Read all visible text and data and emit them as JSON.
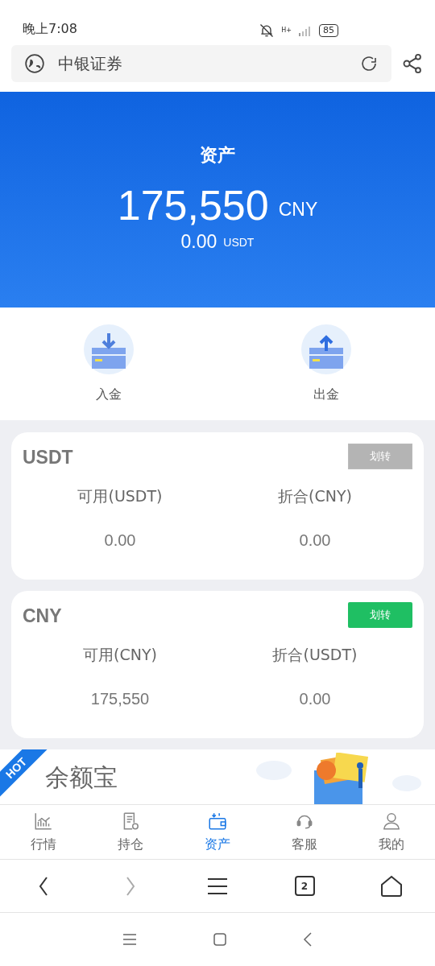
{
  "status_bar": {
    "time": "晚上7:08",
    "network": "H+",
    "battery": "85"
  },
  "address_bar": {
    "title": "中银证券"
  },
  "header": {
    "title": "资产",
    "total": "175,550",
    "total_unit": "CNY",
    "usdt": "0.00",
    "usdt_unit": "USDT"
  },
  "actions": [
    {
      "kind": "deposit",
      "label": "入金"
    },
    {
      "kind": "withdraw",
      "label": "出金"
    }
  ],
  "accounts": [
    {
      "name": "USDT",
      "button": "划转",
      "disabled": true,
      "columns": [
        {
          "label": "可用(USDT)",
          "value": "0.00"
        },
        {
          "label": "折合(CNY)",
          "value": "0.00"
        }
      ]
    },
    {
      "name": "CNY",
      "button": "划转",
      "disabled": false,
      "columns": [
        {
          "label": "可用(CNY)",
          "value": "175,550"
        },
        {
          "label": "折合(USDT)",
          "value": "0.00"
        }
      ]
    }
  ],
  "banner": {
    "ribbon": "HOT",
    "title": "余额宝"
  },
  "tabs": [
    {
      "kind": "chart",
      "label": "行情",
      "selected": false
    },
    {
      "kind": "doc",
      "label": "持仓",
      "selected": false
    },
    {
      "kind": "wallet",
      "label": "资产",
      "selected": true
    },
    {
      "kind": "headset",
      "label": "客服",
      "selected": false
    },
    {
      "kind": "user",
      "label": "我的",
      "selected": false
    }
  ],
  "browser_nav": {
    "tab_count": "2"
  }
}
